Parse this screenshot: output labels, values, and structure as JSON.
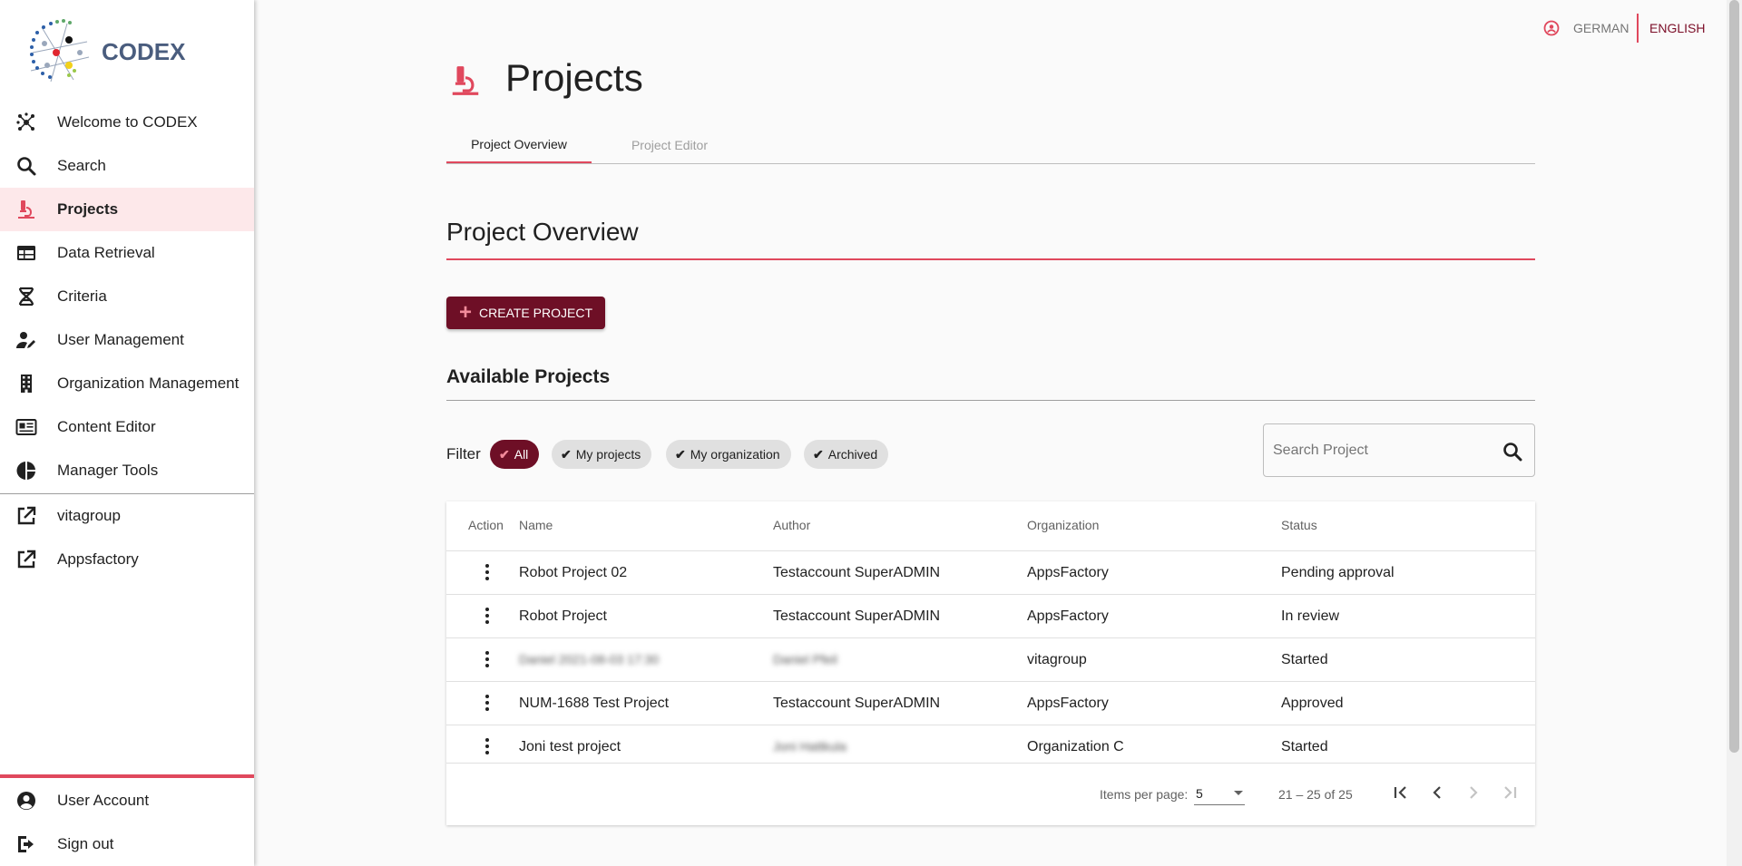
{
  "brand": {
    "name": "CODEX"
  },
  "sidebar": {
    "items": [
      {
        "label": "Welcome to CODEX",
        "icon": "hub-icon"
      },
      {
        "label": "Search",
        "icon": "search-icon"
      },
      {
        "label": "Projects",
        "icon": "microscope-icon",
        "active": true
      },
      {
        "label": "Data Retrieval",
        "icon": "table-icon"
      },
      {
        "label": "Criteria",
        "icon": "dna-icon"
      },
      {
        "label": "User Management",
        "icon": "user-edit-icon"
      },
      {
        "label": "Organization Management",
        "icon": "building-icon"
      },
      {
        "label": "Content Editor",
        "icon": "newspaper-icon"
      },
      {
        "label": "Manager Tools",
        "icon": "pie-chart-icon"
      }
    ],
    "links": [
      {
        "label": "vitagroup",
        "icon": "external-link-icon"
      },
      {
        "label": "Appsfactory",
        "icon": "external-link-icon"
      }
    ],
    "bottom": [
      {
        "label": "User Account",
        "icon": "account-circle-icon"
      },
      {
        "label": "Sign out",
        "icon": "logout-icon"
      }
    ]
  },
  "language": {
    "german": "GERMAN",
    "english": "ENGLISH",
    "selected": "ENGLISH"
  },
  "header": {
    "title": "Projects"
  },
  "tabs": [
    {
      "label": "Project Overview",
      "active": true
    },
    {
      "label": "Project Editor",
      "active": false
    }
  ],
  "section": {
    "title": "Project Overview"
  },
  "create_button": {
    "label": "CREATE PROJECT"
  },
  "available": {
    "title": "Available Projects"
  },
  "filter": {
    "label": "Filter",
    "chips": [
      {
        "label": "All",
        "selected": true
      },
      {
        "label": "My projects",
        "selected": false
      },
      {
        "label": "My organization",
        "selected": false
      },
      {
        "label": "Archived",
        "selected": false
      }
    ]
  },
  "search": {
    "placeholder": "Search Project",
    "value": ""
  },
  "table": {
    "columns": [
      "Action",
      "Name",
      "Author",
      "Organization",
      "Status"
    ],
    "rows": [
      {
        "name": "Robot Project 02",
        "author": "Testaccount SuperADMIN",
        "organization": "AppsFactory",
        "status": "Pending approval",
        "blurred_name": false,
        "blurred_author": false
      },
      {
        "name": "Robot Project",
        "author": "Testaccount SuperADMIN",
        "organization": "AppsFactory",
        "status": "In review",
        "blurred_name": false,
        "blurred_author": false
      },
      {
        "name": "Daniel 2021-08-03 17:30",
        "author": "Daniel Pfeil",
        "organization": "vitagroup",
        "status": "Started",
        "blurred_name": true,
        "blurred_author": true
      },
      {
        "name": "NUM-1688 Test Project",
        "author": "Testaccount SuperADMIN",
        "organization": "AppsFactory",
        "status": "Approved",
        "blurred_name": false,
        "blurred_author": false
      },
      {
        "name": "Joni test project",
        "author": "Joni Hattkula",
        "organization": "Organization C",
        "status": "Started",
        "blurred_name": false,
        "blurred_author": true
      }
    ]
  },
  "paginator": {
    "items_per_page_label": "Items per page:",
    "page_size": "5",
    "range": "21 – 25 of 25"
  },
  "colors": {
    "accent": "#e0485d",
    "brand_dark": "#6e0f26",
    "active_bg": "#fde8ea"
  }
}
